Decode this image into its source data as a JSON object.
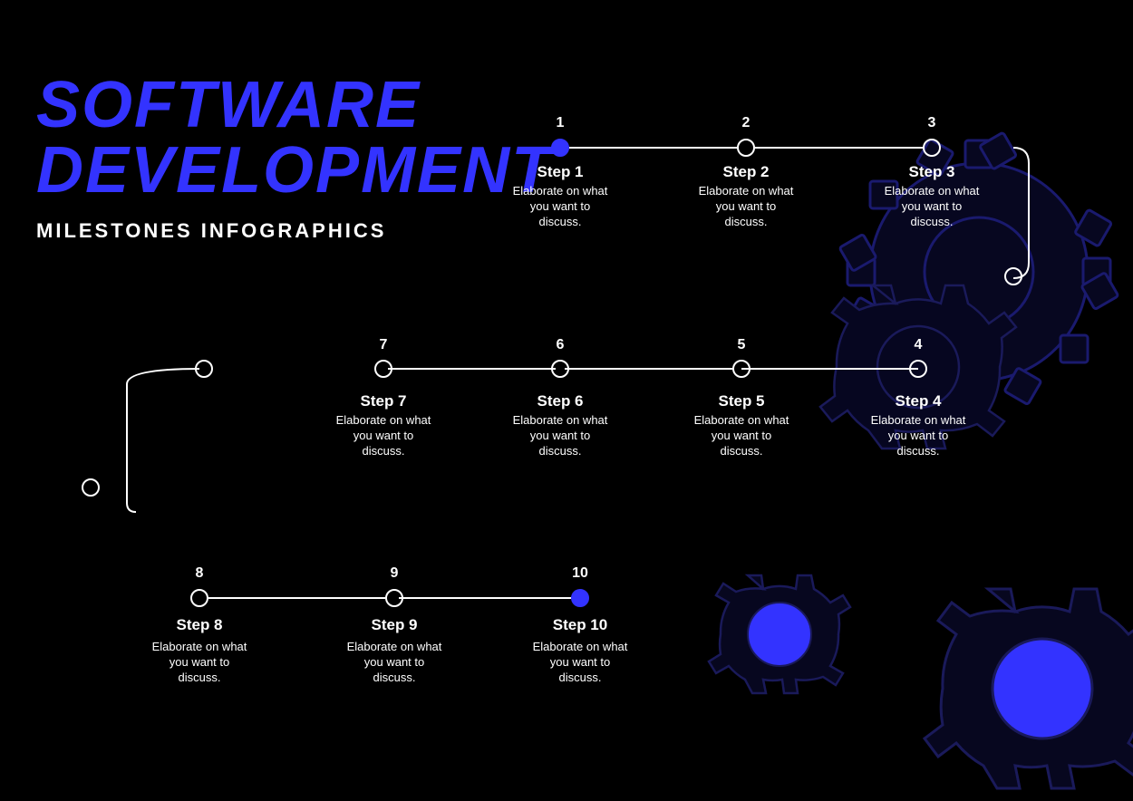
{
  "title": {
    "line1": "SOFTWARE",
    "line2": "DEVELOPMENT",
    "subtitle": "MILESTONES INFOGRAPHICS"
  },
  "steps": [
    {
      "number": "1",
      "label": "Step  1",
      "description": "Elaborate on what you want to discuss.",
      "filled": true
    },
    {
      "number": "2",
      "label": "Step  2",
      "description": "Elaborate on what you want to discuss.",
      "filled": false
    },
    {
      "number": "3",
      "label": "Step  3",
      "description": "Elaborate on what you want to discuss.",
      "filled": false
    },
    {
      "number": "4",
      "label": "Step  4",
      "description": "Elaborate on what you want to discuss.",
      "filled": false
    },
    {
      "number": "5",
      "label": "Step  5",
      "description": "Elaborate on what you want to discuss.",
      "filled": false
    },
    {
      "number": "6",
      "label": "Step  6",
      "description": "Elaborate on what you want to discuss.",
      "filled": false
    },
    {
      "number": "7",
      "label": "Step  7",
      "description": "Elaborate on what you want to discuss.",
      "filled": false
    },
    {
      "number": "8",
      "label": "Step  8",
      "description": "Elaborate on what you want to discuss.",
      "filled": false
    },
    {
      "number": "9",
      "label": "Step  9",
      "description": "Elaborate on what you want to discuss.",
      "filled": false
    },
    {
      "number": "10",
      "label": "Step  10",
      "description": "Elaborate on what you want to discuss.",
      "filled": true
    }
  ],
  "colors": {
    "bg": "#000000",
    "accent": "#3333ff",
    "text": "#ffffff",
    "gear_stroke": "#1a1a6e",
    "gear_fill": "#0a0a3a"
  }
}
